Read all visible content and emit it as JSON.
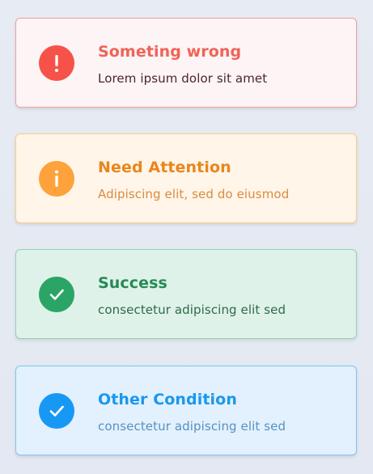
{
  "alerts": {
    "error": {
      "title": "Someting wrong",
      "message": "Lorem ipsum dolor sit amet",
      "icon": "exclamation-icon",
      "color": "#f65249"
    },
    "warning": {
      "title": "Need Attention",
      "message": "Adipiscing elit, sed do eiusmod",
      "icon": "info-icon",
      "color": "#fea23c"
    },
    "success": {
      "title": "Success",
      "message": "consectetur adipiscing elit sed",
      "icon": "checkmark-icon",
      "color": "#2aa565"
    },
    "info": {
      "title": "Other Condition",
      "message": "consectetur adipiscing elit sed",
      "icon": "checkmark-icon",
      "color": "#1898f5"
    }
  }
}
